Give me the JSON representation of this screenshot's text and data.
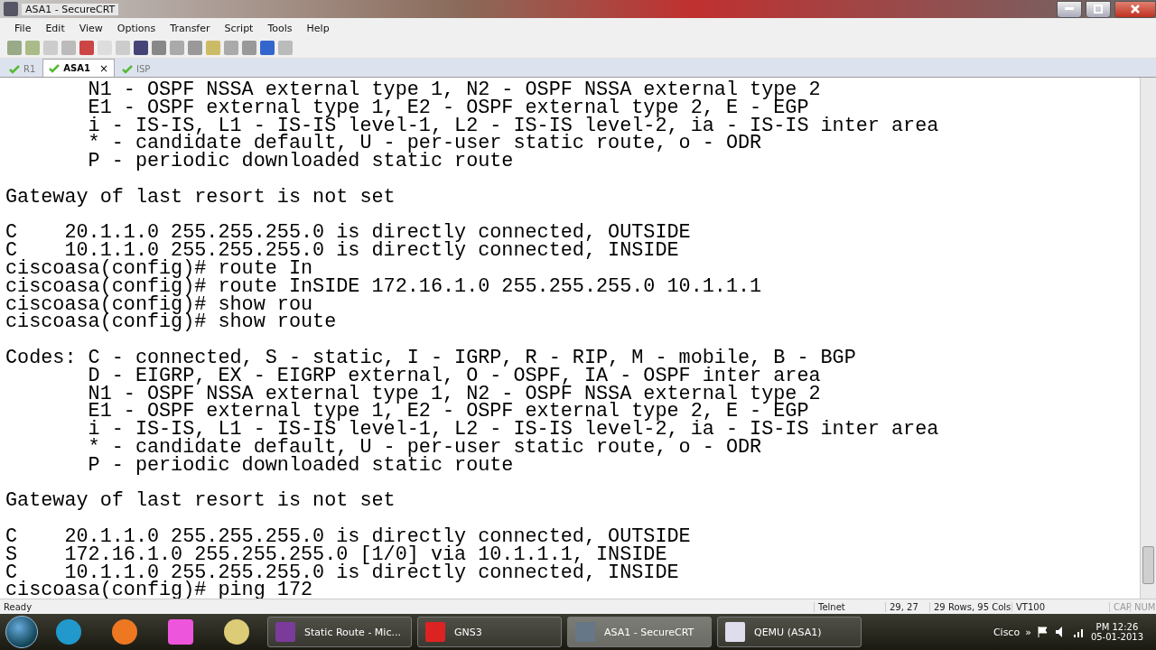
{
  "window": {
    "title": "ASA1 - SecureCRT"
  },
  "menu": [
    "File",
    "Edit",
    "View",
    "Options",
    "Transfer",
    "Script",
    "Tools",
    "Help"
  ],
  "tabs": [
    {
      "label": "R1",
      "selected": false,
      "closable": false
    },
    {
      "label": "ASA1",
      "selected": true,
      "closable": true,
      "close": "×"
    },
    {
      "label": "ISP",
      "selected": false,
      "closable": false
    }
  ],
  "terminal": {
    "blocks": [
      [
        "       N1 - OSPF NSSA external type 1, N2 - OSPF NSSA external type 2",
        "       E1 - OSPF external type 1, E2 - OSPF external type 2, E - EGP",
        "       i - IS-IS, L1 - IS-IS level-1, L2 - IS-IS level-2, ia - IS-IS inter area",
        "       * - candidate default, U - per-user static route, o - ODR",
        "       P - periodic downloaded static route"
      ],
      [
        "Gateway of last resort is not set"
      ],
      [
        "C    20.1.1.0 255.255.255.0 is directly connected, OUTSIDE",
        "C    10.1.1.0 255.255.255.0 is directly connected, INSIDE",
        "ciscoasa(config)# route In",
        "ciscoasa(config)# route InSIDE 172.16.1.0 255.255.255.0 10.1.1.1",
        "ciscoasa(config)# show rou",
        "ciscoasa(config)# show route"
      ],
      [
        "Codes: C - connected, S - static, I - IGRP, R - RIP, M - mobile, B - BGP",
        "       D - EIGRP, EX - EIGRP external, O - OSPF, IA - OSPF inter area",
        "       N1 - OSPF NSSA external type 1, N2 - OSPF NSSA external type 2",
        "       E1 - OSPF external type 1, E2 - OSPF external type 2, E - EGP",
        "       i - IS-IS, L1 - IS-IS level-1, L2 - IS-IS level-2, ia - IS-IS inter area",
        "       * - candidate default, U - per-user static route, o - ODR",
        "       P - periodic downloaded static route"
      ],
      [
        "Gateway of last resort is not set"
      ],
      [
        "C    20.1.1.0 255.255.255.0 is directly connected, OUTSIDE",
        "S    172.16.1.0 255.255.255.0 [1/0] via 10.1.1.1, INSIDE",
        "C    10.1.1.0 255.255.255.0 is directly connected, INSIDE",
        "ciscoasa(config)# ping 172"
      ]
    ]
  },
  "status_bar": {
    "message": "Ready",
    "protocol": "Telnet",
    "cursor": "29,  27",
    "size": "29 Rows,  95 Cols",
    "emulation": "VT100",
    "cap": "CAP",
    "num": "NUM"
  },
  "taskbar": {
    "buttons": [
      {
        "label": "Static Route - Mic...",
        "kind": "onenote",
        "selected": false
      },
      {
        "label": "GNS3",
        "kind": "gns3",
        "selected": false
      },
      {
        "label": "ASA1 - SecureCRT",
        "kind": "securecrt",
        "selected": true
      },
      {
        "label": "QEMU (ASA1)",
        "kind": "qemu",
        "selected": false
      }
    ],
    "toolbar_label": "Cisco",
    "chevron": "»",
    "time": "PM 12:26",
    "date": "05-01-2013"
  }
}
